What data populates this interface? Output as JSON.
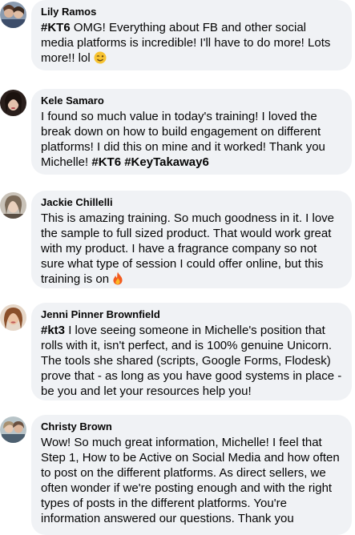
{
  "comments": [
    {
      "author": "Lily Ramos",
      "hashtag": "#KT6",
      "text": " OMG! Everything about FB and other social media platforms is incredible! I'll have to do more! Lots more!! lol ",
      "emoji": "winking-face-icon"
    },
    {
      "author": "Kele Samaro",
      "text": "I found so much value in today's training! I loved the break down on how to build engagement on different platforms! I did this on mine and it worked! Thank you Michelle! ",
      "hashtags": "#KT6 #KeyTakaway6"
    },
    {
      "author": "Jackie Chillelli",
      "text": "This is amazing training. So much goodness in it. I love the sample to full sized product. That would work great with my product. I have a fragrance company so not sure what type of session I could offer online, but this training is on ",
      "emoji": "fire-icon"
    },
    {
      "author": "Jenni Pinner Brownfield",
      "hashtag": "#kt3",
      "text": " I love seeing someone in Michelle's position that rolls with it, isn't perfect, and is 100% genuine Unicorn. The tools she shared (scripts, Google Forms, Flodesk) prove that - as long as you have good systems in place - be you and let your resources help you!"
    },
    {
      "author": "Christy Brown",
      "text": "Wow! So much great information, Michelle! I feel that Step 1, How to be Active on Social Media and how often to post on the different platforms. As direct sellers, we often wonder if we're posting enough and with the right types of posts in the different platforms. You're information answered our questions. Thank you"
    }
  ]
}
